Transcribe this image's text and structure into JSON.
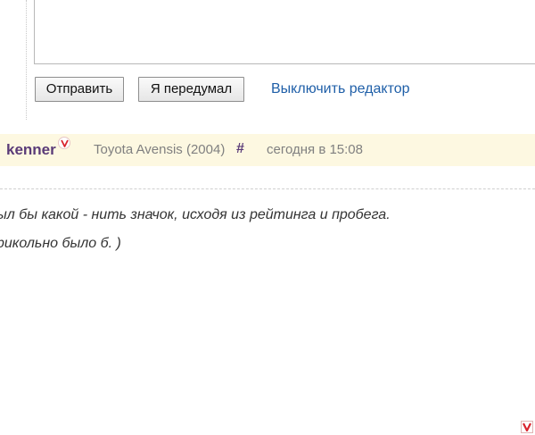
{
  "reply_form": {
    "textarea_value": "",
    "send_label": "Отправить",
    "cancel_label": "Я передумал",
    "editor_toggle_label": "Выключить редактор"
  },
  "comment": {
    "author": "kenner",
    "car": "Toyota Avensis (2004)",
    "anchor": "#",
    "timestamp": "сегодня в 15:08",
    "body_lines": [
      "ыл бы какой - нить значок, исходя из рейтинга и пробега.",
      "рикольно было б. )"
    ]
  },
  "colors": {
    "author": "#5a3b78",
    "link": "#1f5fa8",
    "header_bg": "#fdf8e1",
    "badge": "#d9232e"
  },
  "icons": {
    "author_badge": "verified-v-icon",
    "corner_badge": "v-logo-icon"
  }
}
